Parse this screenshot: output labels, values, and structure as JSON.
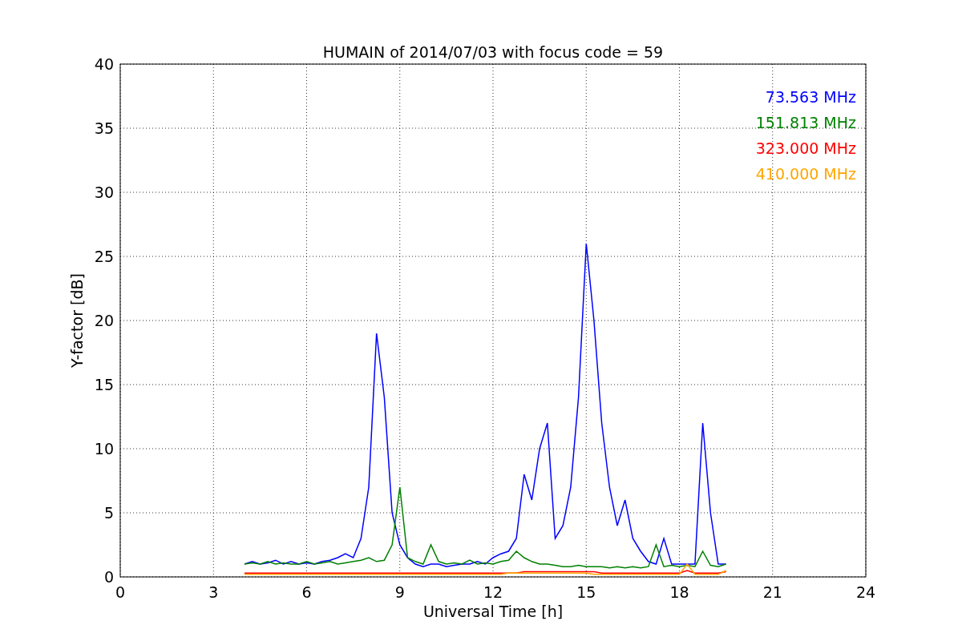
{
  "figure": {
    "chart_data": {
      "type": "line",
      "title": "HUMAIN of 2014/07/03 with focus code = 59",
      "xlabel": "Universal Time [h]",
      "ylabel": "Y-factor [dB]",
      "grid": true,
      "xlim": [
        0,
        24
      ],
      "ylim": [
        0,
        40
      ],
      "xticks": [
        0,
        3,
        6,
        9,
        12,
        15,
        18,
        21,
        24
      ],
      "yticks": [
        0,
        5,
        10,
        15,
        20,
        25,
        30,
        35,
        40
      ],
      "x": [
        4,
        4.25,
        4.5,
        4.75,
        5,
        5.25,
        5.5,
        5.75,
        6,
        6.25,
        6.5,
        6.75,
        7,
        7.25,
        7.5,
        7.75,
        8,
        8.25,
        8.5,
        8.75,
        9,
        9.25,
        9.5,
        9.75,
        10,
        10.25,
        10.5,
        10.75,
        11,
        11.25,
        11.5,
        11.75,
        12,
        12.25,
        12.5,
        12.75,
        13,
        13.25,
        13.5,
        13.75,
        14,
        14.25,
        14.5,
        14.75,
        15,
        15.25,
        15.5,
        15.75,
        16,
        16.25,
        16.5,
        16.75,
        17,
        17.25,
        17.5,
        17.75,
        18,
        18.25,
        18.5,
        18.75,
        19,
        19.25,
        19.5
      ],
      "series": [
        {
          "name": "73.563 MHz",
          "color": "#0000ff",
          "values": [
            1.0,
            1.2,
            1.0,
            1.1,
            1.3,
            1.0,
            1.2,
            1.0,
            1.1,
            1.0,
            1.2,
            1.3,
            1.5,
            1.8,
            1.5,
            3.0,
            7.0,
            19.0,
            14.0,
            5.0,
            2.5,
            1.5,
            1.0,
            0.8,
            1.0,
            1.0,
            0.8,
            0.9,
            1.0,
            1.0,
            1.2,
            1.0,
            1.5,
            1.8,
            2.0,
            3.0,
            8.0,
            6.0,
            10.0,
            12.0,
            3.0,
            4.0,
            7.0,
            14.0,
            26.0,
            20.0,
            12.0,
            7.0,
            4.0,
            6.0,
            3.0,
            2.0,
            1.2,
            1.0,
            3.0,
            1.0,
            1.0,
            1.0,
            1.0,
            12.0,
            5.0,
            1.0,
            1.0
          ]
        },
        {
          "name": "151.813 MHz",
          "color": "#008000",
          "values": [
            1.0,
            1.1,
            1.0,
            1.2,
            1.0,
            1.1,
            1.0,
            1.0,
            1.2,
            1.0,
            1.1,
            1.2,
            1.0,
            1.1,
            1.2,
            1.3,
            1.5,
            1.2,
            1.3,
            2.5,
            7.0,
            1.5,
            1.2,
            1.0,
            2.5,
            1.2,
            1.0,
            1.1,
            1.0,
            1.3,
            1.0,
            1.1,
            1.0,
            1.2,
            1.3,
            2.0,
            1.5,
            1.2,
            1.0,
            1.0,
            0.9,
            0.8,
            0.8,
            0.9,
            0.8,
            0.8,
            0.8,
            0.7,
            0.8,
            0.7,
            0.8,
            0.7,
            0.8,
            2.5,
            0.8,
            0.9,
            0.8,
            0.9,
            0.8,
            2.0,
            0.9,
            0.8,
            1.0
          ]
        },
        {
          "name": "323.000 MHz",
          "color": "#ff0000",
          "values": [
            0.3,
            0.3,
            0.3,
            0.3,
            0.3,
            0.3,
            0.3,
            0.3,
            0.3,
            0.3,
            0.3,
            0.3,
            0.3,
            0.3,
            0.3,
            0.3,
            0.3,
            0.3,
            0.3,
            0.3,
            0.3,
            0.3,
            0.3,
            0.3,
            0.3,
            0.3,
            0.3,
            0.3,
            0.3,
            0.3,
            0.3,
            0.3,
            0.3,
            0.3,
            0.3,
            0.3,
            0.4,
            0.4,
            0.4,
            0.4,
            0.4,
            0.4,
            0.4,
            0.4,
            0.4,
            0.4,
            0.3,
            0.3,
            0.3,
            0.3,
            0.3,
            0.3,
            0.3,
            0.3,
            0.3,
            0.3,
            0.3,
            0.5,
            0.3,
            0.3,
            0.3,
            0.3,
            0.4
          ]
        },
        {
          "name": "410.000 MHz",
          "color": "#ffa500",
          "values": [
            0.2,
            0.2,
            0.2,
            0.2,
            0.2,
            0.2,
            0.2,
            0.2,
            0.2,
            0.2,
            0.2,
            0.2,
            0.2,
            0.2,
            0.2,
            0.2,
            0.2,
            0.2,
            0.2,
            0.2,
            0.2,
            0.2,
            0.2,
            0.2,
            0.2,
            0.2,
            0.2,
            0.2,
            0.2,
            0.2,
            0.2,
            0.2,
            0.2,
            0.2,
            0.3,
            0.3,
            0.3,
            0.3,
            0.3,
            0.3,
            0.3,
            0.3,
            0.3,
            0.3,
            0.3,
            0.2,
            0.2,
            0.2,
            0.2,
            0.2,
            0.2,
            0.2,
            0.2,
            0.2,
            0.2,
            0.2,
            0.2,
            1.0,
            0.2,
            0.2,
            0.2,
            0.2,
            0.5
          ]
        }
      ]
    }
  }
}
